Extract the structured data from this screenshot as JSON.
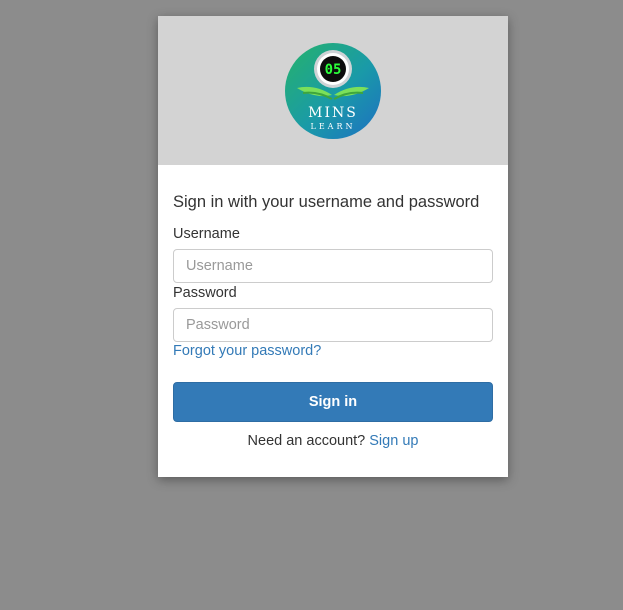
{
  "banner": {
    "logo_text_top": "05",
    "logo_text_main": "MINS",
    "logo_text_sub": "LEARN"
  },
  "form": {
    "heading": "Sign in with your username and password",
    "username_label": "Username",
    "username_placeholder": "Username",
    "username_value": "",
    "password_label": "Password",
    "password_placeholder": "Password",
    "password_value": "",
    "forgot_link": "Forgot your password?",
    "signin_button": "Sign in",
    "signup_prompt": "Need an account?",
    "signup_link": "Sign up"
  },
  "colors": {
    "background": "#8c8c8c",
    "banner": "#d3d3d3",
    "primary": "#337ab7"
  }
}
